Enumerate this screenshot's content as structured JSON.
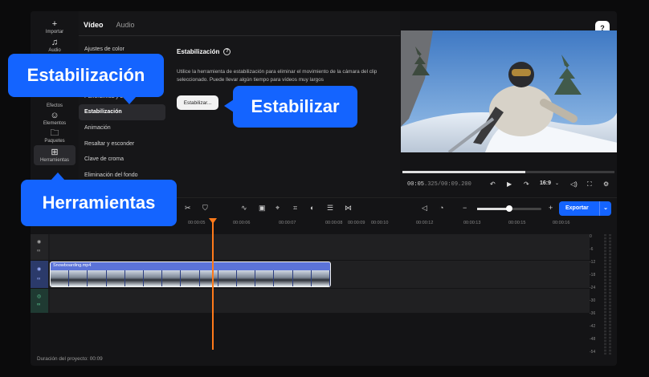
{
  "rail": {
    "items": [
      {
        "icon": "+",
        "label": "Importar"
      },
      {
        "icon": "♫",
        "label": "Audio"
      },
      {
        "icon": "✦",
        "label": "Efectos"
      },
      {
        "icon": "☺",
        "label": "Elementos"
      },
      {
        "icon": "🗀",
        "label": "Paquetes"
      },
      {
        "icon": "⊞",
        "label": "Herramientas"
      }
    ]
  },
  "panel": {
    "tabs": [
      "Vídeo",
      "Audio"
    ],
    "menu": [
      "Ajustes de color",
      "",
      "",
      "Panorámica y zoom",
      "Estabilización",
      "Animación",
      "Resaltar y esconder",
      "Clave de croma",
      "Eliminación del fondo"
    ],
    "detail_title": "Estabilización",
    "detail_text": "Utilice la herramienta de estabilización para eliminar el movimiento de la cámara del clip seleccionado. Puede llevar algún tiempo para vídeos muy largos",
    "stabilize_button": "Estabilizar..."
  },
  "preview": {
    "help": "?",
    "time_current": "00:05",
    "time_current_ms": ".325",
    "time_total": "/00:09.200",
    "aspect": "16:9",
    "progress": 0.58
  },
  "timeline": {
    "ticks": [
      "00:00:05",
      "00:00:06",
      "00:00:07",
      "00:00:08",
      "00:00:09",
      "00:00:10",
      "00:00:12",
      "00:00:13",
      "00:00:15",
      "00:00:16"
    ],
    "clip_name": "Snowboarding.mp4",
    "export_label": "Exportar",
    "duration": "Duración del proyecto: 00:09",
    "meter_labels": [
      "0",
      "-6",
      "-12",
      "-18",
      "-24",
      "-30",
      "-36",
      "-42",
      "-48",
      "-54"
    ]
  },
  "callouts": {
    "stabilization": "Estabilización",
    "stabilize": "Estabilizar",
    "tools": "Herramientas"
  },
  "colors": {
    "accent": "#1464ff",
    "playhead": "#ff7a1a",
    "clip": "#5b73d8"
  }
}
